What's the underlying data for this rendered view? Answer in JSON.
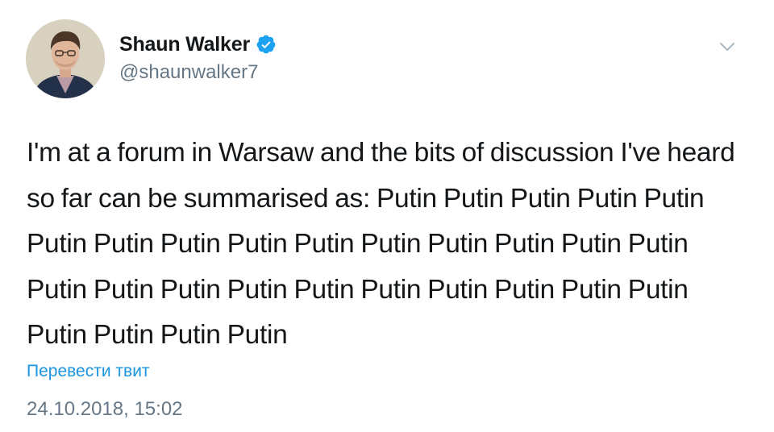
{
  "user": {
    "display_name": "Shaun Walker",
    "handle": "@shaunwalker7",
    "verified": true,
    "avatar_icon": "profile-photo"
  },
  "tweet": {
    "text": "I'm at a forum in Warsaw and the bits of discussion I've heard so far can be summarised as: Putin Putin Putin Putin Putin Putin Putin Putin Putin Putin Putin Putin Putin Putin Putin Putin Putin Putin Putin Putin Putin Putin Putin Putin Putin Putin Putin Putin Putin",
    "translate_label": "Перевести твит",
    "timestamp": "24.10.2018, 15:02"
  },
  "menu": {
    "icon": "chevron-down-icon"
  },
  "colors": {
    "text": "#14171a",
    "secondary": "#657786",
    "link": "#1b95e0",
    "verified": "#1da1f2"
  }
}
